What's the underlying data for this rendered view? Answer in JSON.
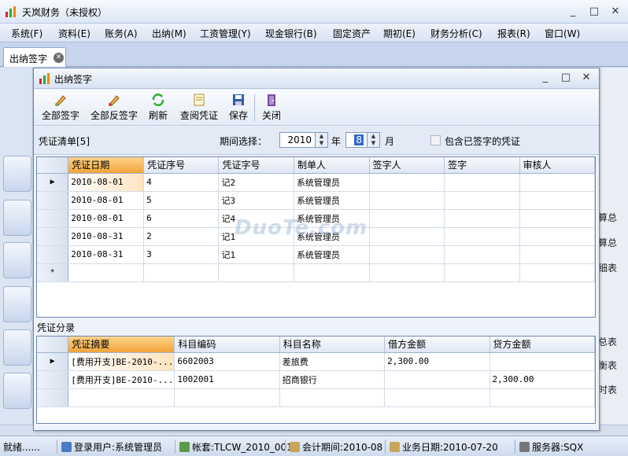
{
  "app": {
    "title": "天岚财务（未授权）",
    "min": "_",
    "max": "□",
    "close": "✕"
  },
  "menu": [
    "系统(F)",
    "资料(E)",
    "账务(A)",
    "出纳(M)",
    "工资管理(Y)",
    "现金银行(B)",
    "固定资产",
    "期初(E)",
    "财务分析(C)",
    "报表(R)",
    "窗口(W)"
  ],
  "tab": {
    "label": "出纳签字",
    "close": "✕"
  },
  "background_right_labels": [
    "算总",
    "算总",
    "细表",
    "总表",
    "衡表",
    "时表"
  ],
  "dialog": {
    "title": "出纳签字",
    "toolbar": [
      {
        "label": "全部签字",
        "icon": "sign-all-icon"
      },
      {
        "label": "全部反签字",
        "icon": "unsign-all-icon"
      },
      {
        "label": "刷新",
        "icon": "refresh-icon"
      },
      {
        "label": "查阅凭证",
        "icon": "view-voucher-icon"
      },
      {
        "label": "保存",
        "icon": "save-icon"
      },
      {
        "label": "关闭",
        "icon": "close-icon"
      }
    ],
    "voucher_list_label": "凭证清单[5]",
    "period_label": "期间选择：",
    "year": "2010",
    "year_unit": "年",
    "month": "8",
    "month_unit": "月",
    "include_signed_label": "包含已签字的凭证",
    "include_signed_checked": false,
    "voucher_columns": [
      "凭证日期",
      "凭证序号",
      "凭证字号",
      "制单人",
      "签字人",
      "签字",
      "审核人"
    ],
    "vouchers": [
      [
        "2010-08-01",
        "4",
        "记2",
        "系统管理员",
        "",
        "",
        ""
      ],
      [
        "2010-08-01",
        "5",
        "记3",
        "系统管理员",
        "",
        "",
        ""
      ],
      [
        "2010-08-01",
        "6",
        "记4",
        "系统管理员",
        "",
        "",
        ""
      ],
      [
        "2010-08-31",
        "2",
        "记1",
        "系统管理员",
        "",
        "",
        ""
      ],
      [
        "2010-08-31",
        "3",
        "记1",
        "系统管理员",
        "",
        "",
        ""
      ]
    ],
    "new_row_marker": "*",
    "entries_label": "凭证分录",
    "entry_columns": [
      "凭证摘要",
      "科目编码",
      "科目名称",
      "借方金额",
      "贷方金额"
    ],
    "entries": [
      [
        "[费用开支]BE-2010-...",
        "6602003",
        "差旅费",
        "2,300.00",
        ""
      ],
      [
        "[费用开支]BE-2010-...",
        "1002001",
        "招商银行",
        "",
        "2,300.00"
      ]
    ]
  },
  "status": {
    "ready": "就绪......",
    "user": "登录用户:系统管理员",
    "account": "帐套:TLCW_2010_001",
    "period": "会计期间:2010-08",
    "bizdate": "业务日期:2010-07-20",
    "server": "服务器:SQX"
  },
  "watermark": "DuoTe.com",
  "colors": {
    "accent": "#f2a43a",
    "frame": "#6f87b3"
  }
}
